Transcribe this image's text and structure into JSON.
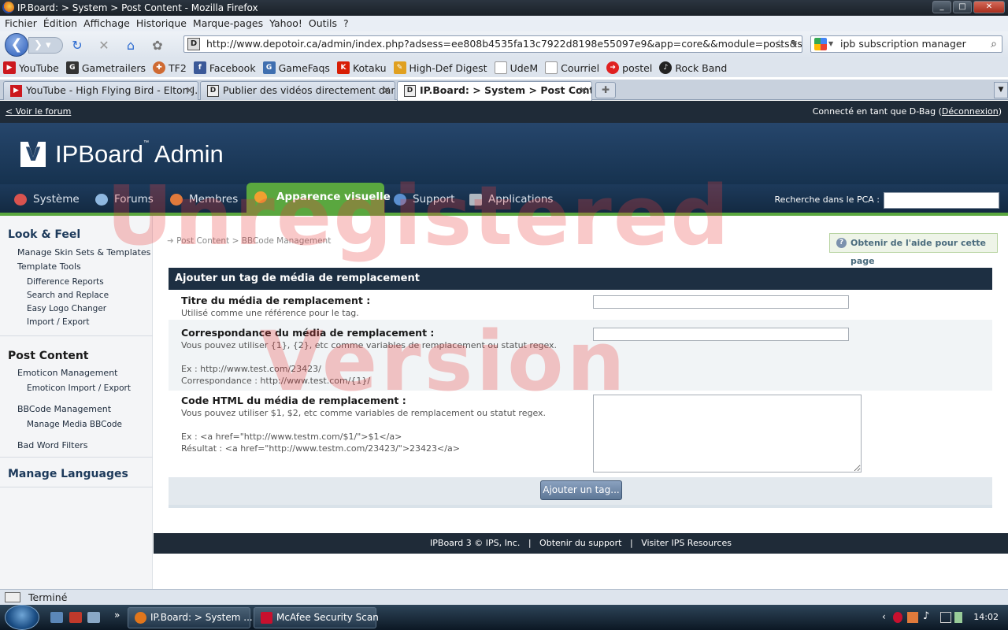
{
  "browser": {
    "window_title": "IP.Board: > System > Post Content - Mozilla Firefox",
    "menu": [
      "Fichier",
      "Édition",
      "Affichage",
      "Historique",
      "Marque-pages",
      "Yahoo!",
      "Outils",
      "?"
    ],
    "url": "http://www.depotoir.ca/admin/index.php?adsess=ee808b4535fa13c7922d8198e55097e9&app=core&&module=posts&section=media&",
    "search_query": "ipb subscription manager",
    "bookmarks": [
      {
        "label": "YouTube",
        "icon": "youtube-icon",
        "color": "#cc181e"
      },
      {
        "label": "Gametrailers",
        "icon": "gametrailers-icon",
        "color": "#333333"
      },
      {
        "label": "TF2",
        "icon": "tf2-icon",
        "color": "#cf6a32"
      },
      {
        "label": "Facebook",
        "icon": "facebook-icon",
        "color": "#3b5998"
      },
      {
        "label": "GameFaqs",
        "icon": "gamefaqs-icon",
        "color": "#3f6fb0"
      },
      {
        "label": "Kotaku",
        "icon": "kotaku-icon",
        "color": "#d81e05"
      },
      {
        "label": "High-Def Digest",
        "icon": "hddigest-icon",
        "color": "#e0a020"
      },
      {
        "label": "UdeM",
        "icon": "page-icon",
        "color": "#ffffff"
      },
      {
        "label": "Courriel",
        "icon": "page-icon",
        "color": "#ffffff"
      },
      {
        "label": "postel",
        "icon": "postel-icon",
        "color": "#e02020"
      },
      {
        "label": "Rock Band",
        "icon": "rockband-icon",
        "color": "#222222"
      }
    ],
    "tabs": [
      {
        "label": "YouTube - High Flying Bird - Elton J...",
        "active": false
      },
      {
        "label": "Publier des vidéos directement dan...",
        "active": false
      },
      {
        "label": "IP.Board: > System > Post Content",
        "active": true
      }
    ],
    "status": "Terminé"
  },
  "acp": {
    "back_link": "< Voir le forum",
    "logged_in_prefix": "Connecté en tant que D-Bag (",
    "logout": "Déconnexion",
    "logged_in_suffix": ")",
    "logo_main": "IPBoard",
    "logo_tm": "™",
    "logo_admin": "Admin",
    "nav": [
      {
        "label": "Système",
        "icon": "system-icon",
        "color": "#d9534f"
      },
      {
        "label": "Forums",
        "icon": "forums-icon",
        "color": "#8fb8e0"
      },
      {
        "label": "Membres",
        "icon": "members-icon",
        "color": "#e07a3b"
      },
      {
        "label": "Apparence visuelle",
        "icon": "appearance-icon",
        "color": "#f0a030"
      },
      {
        "label": "Support",
        "icon": "support-icon",
        "color": "#5a8fd0"
      },
      {
        "label": "Applications",
        "icon": "applications-icon",
        "color": "#b0b8c0"
      }
    ],
    "search_label": "Recherche dans le PCA :",
    "accent": "#5aa73f"
  },
  "sidebar": {
    "sections": [
      {
        "title": "Look & Feel"
      },
      {
        "title": "Post Content"
      },
      {
        "title": "Manage Languages"
      }
    ],
    "look_feel": {
      "manage_skins": "Manage Skin Sets & Templates",
      "template_tools": "Template Tools",
      "difference_reports": "Difference Reports",
      "search_replace": "Search and Replace",
      "easy_logo": "Easy Logo Changer",
      "import_export": "Import / Export"
    },
    "post_content": {
      "emoticon_mgmt": "Emoticon Management",
      "emoticon_ie": "Emoticon Import / Export",
      "bbcode_mgmt": "BBCode Management",
      "media_bbcode": "Manage Media BBCode",
      "bad_words": "Bad Word Filters"
    }
  },
  "main": {
    "breadcrumb_1": "Post Content",
    "breadcrumb_sep": ">",
    "breadcrumb_2": "BBCode Management",
    "help_button": "Obtenir de l'aide pour cette page",
    "form_title": "Ajouter un tag de média de remplacement",
    "field1_label": "Titre du média de remplacement :",
    "field1_desc": "Utilisé comme une référence pour le tag.",
    "field1_value": "",
    "field2_label": "Correspondance du média de remplacement :",
    "field2_desc": "Vous pouvez utiliser {1}, {2}, etc comme variables de remplacement ou statut regex.\n\nEx : http://www.test.com/23423/\nCorrespondance : http://www.test.com/{1}/",
    "field2_value": "",
    "field3_label": "Code HTML du média de remplacement :",
    "field3_desc": "Vous pouvez utiliser $1, $2, etc comme variables de remplacement ou statut regex.\n\nEx : <a href=\"http://www.testm.com/$1/\">$1</a>\nRésultat : <a href=\"http://www.testm.com/23423/\">23423</a>",
    "field3_value": "",
    "submit": "Ajouter un tag..."
  },
  "footer": {
    "copyright": "IPBoard 3 © IPS, Inc.",
    "support": "Obtenir du support",
    "resources": "Visiter IPS Resources",
    "sep": "|"
  },
  "watermark": {
    "line1": "Unregistered",
    "line2": "Version"
  },
  "taskbar": {
    "buttons": [
      {
        "label": "IP.Board: > System ...",
        "icon": "firefox-icon",
        "color": "#e2761b"
      },
      {
        "label": "McAfee Security Scan",
        "icon": "mcafee-icon",
        "color": "#c8102e"
      }
    ],
    "time": "14:02"
  }
}
